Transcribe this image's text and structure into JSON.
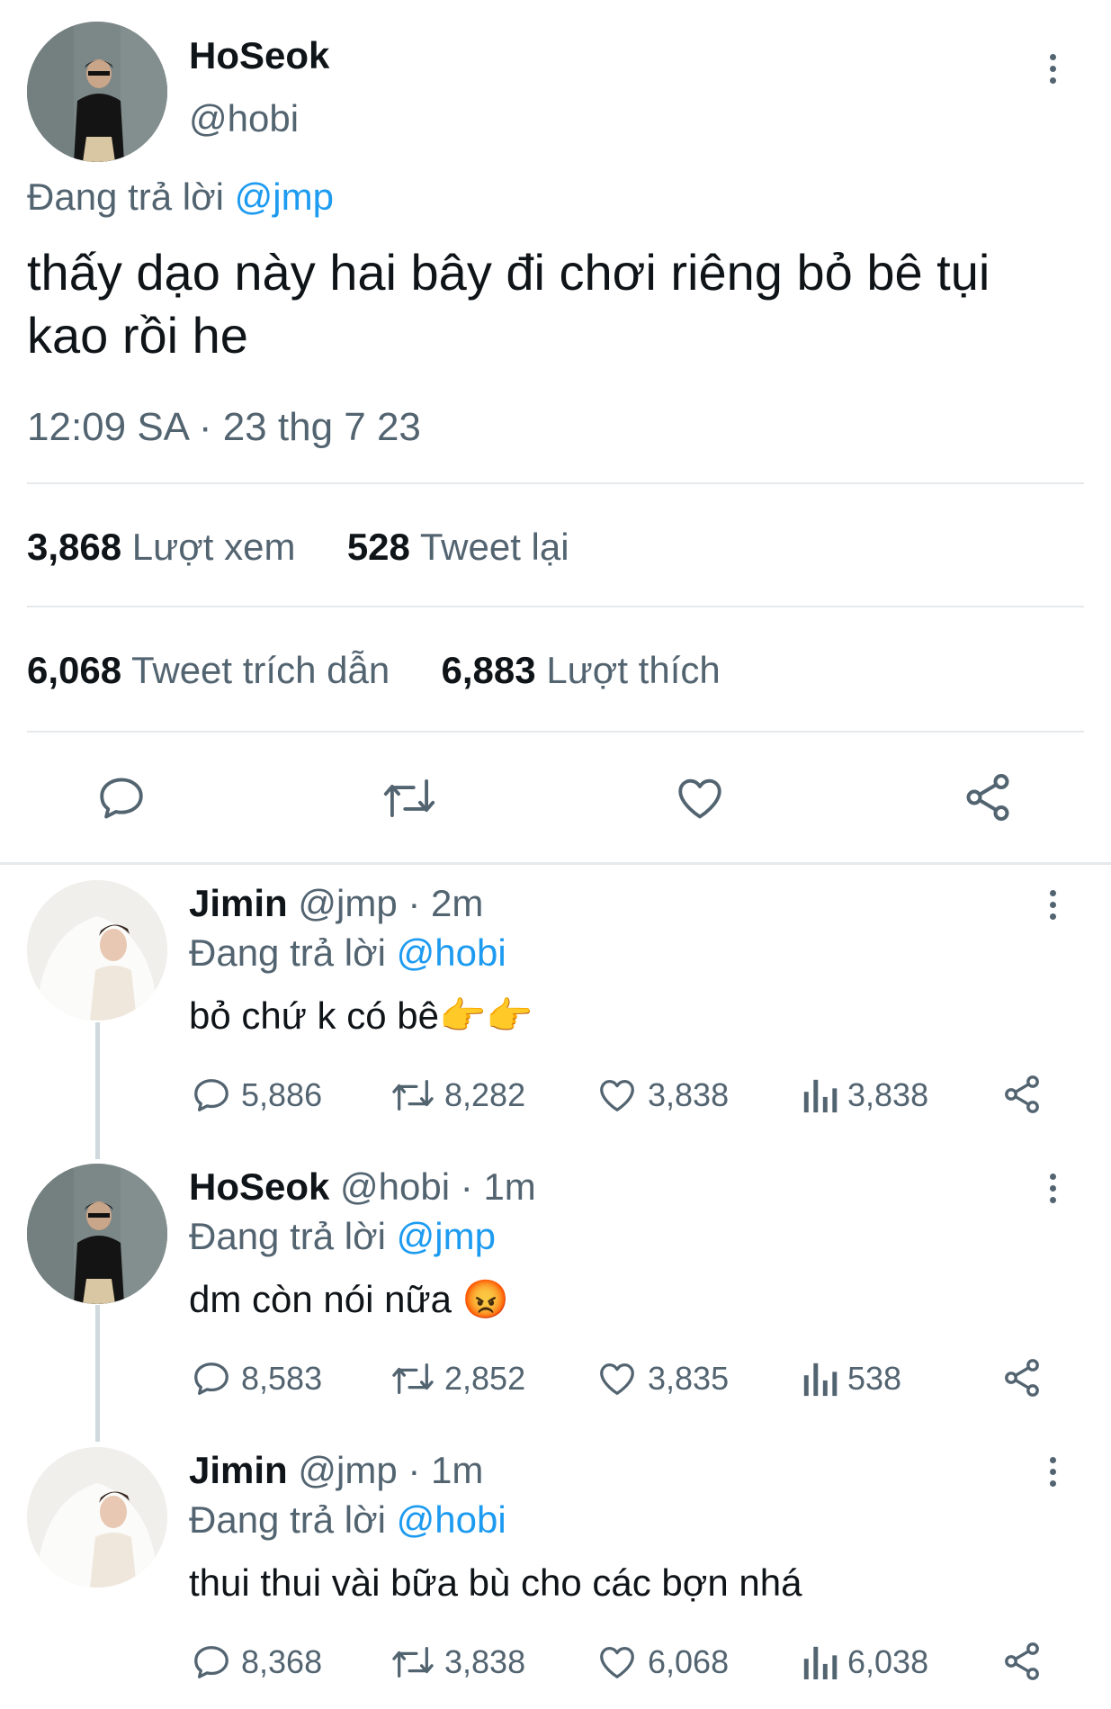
{
  "main_tweet": {
    "display_name": "HoSeok",
    "handle": "@hobi",
    "replying_label": "Đang trả lời",
    "replying_handle": "@jmp",
    "text": "thấy dạo này hai bây đi chơi riêng bỏ bê tụi kao rồi he",
    "time": "12:09 SA · 23 thg 7 23",
    "stats": {
      "views_count": "3,868",
      "views_label": "Lượt xem",
      "retweets_count": "528",
      "retweets_label": "Tweet lại",
      "quotes_count": "6,068",
      "quotes_label": "Tweet trích dẫn",
      "likes_count": "6,883",
      "likes_label": "Lượt thích"
    }
  },
  "replies": [
    {
      "display_name": "Jimin",
      "handle": "@jmp",
      "sep": "·",
      "time": "2m",
      "replying_label": "Đang trả lời",
      "replying_handle": "@hobi",
      "text": "bỏ chứ k có bê",
      "emoji": "👉👉",
      "replies": "5,886",
      "retweets": "8,282",
      "likes": "3,838",
      "views": "3,838"
    },
    {
      "display_name": "HoSeok",
      "handle": "@hobi",
      "sep": "·",
      "time": "1m",
      "replying_label": "Đang trả lời",
      "replying_handle": "@jmp",
      "text": "dm còn nói nữa",
      "emoji": "😡",
      "replies": "8,583",
      "retweets": "2,852",
      "likes": "3,835",
      "views": "538"
    },
    {
      "display_name": "Jimin",
      "handle": "@jmp",
      "sep": "·",
      "time": "1m",
      "replying_label": "Đang trả lời",
      "replying_handle": "@hobi",
      "text": "thui thui vài bữa bù cho các bợn nhá",
      "replies": "8,368",
      "retweets": "3,838",
      "likes": "6,068",
      "views": "6,038"
    }
  ],
  "colors": {
    "accent": "#1d9bf0",
    "text": "#0f1419",
    "muted": "#536471",
    "divider": "#e6e9eb"
  },
  "icons": [
    "reply-icon",
    "retweet-icon",
    "like-icon",
    "share-icon",
    "views-icon",
    "more-icon"
  ]
}
